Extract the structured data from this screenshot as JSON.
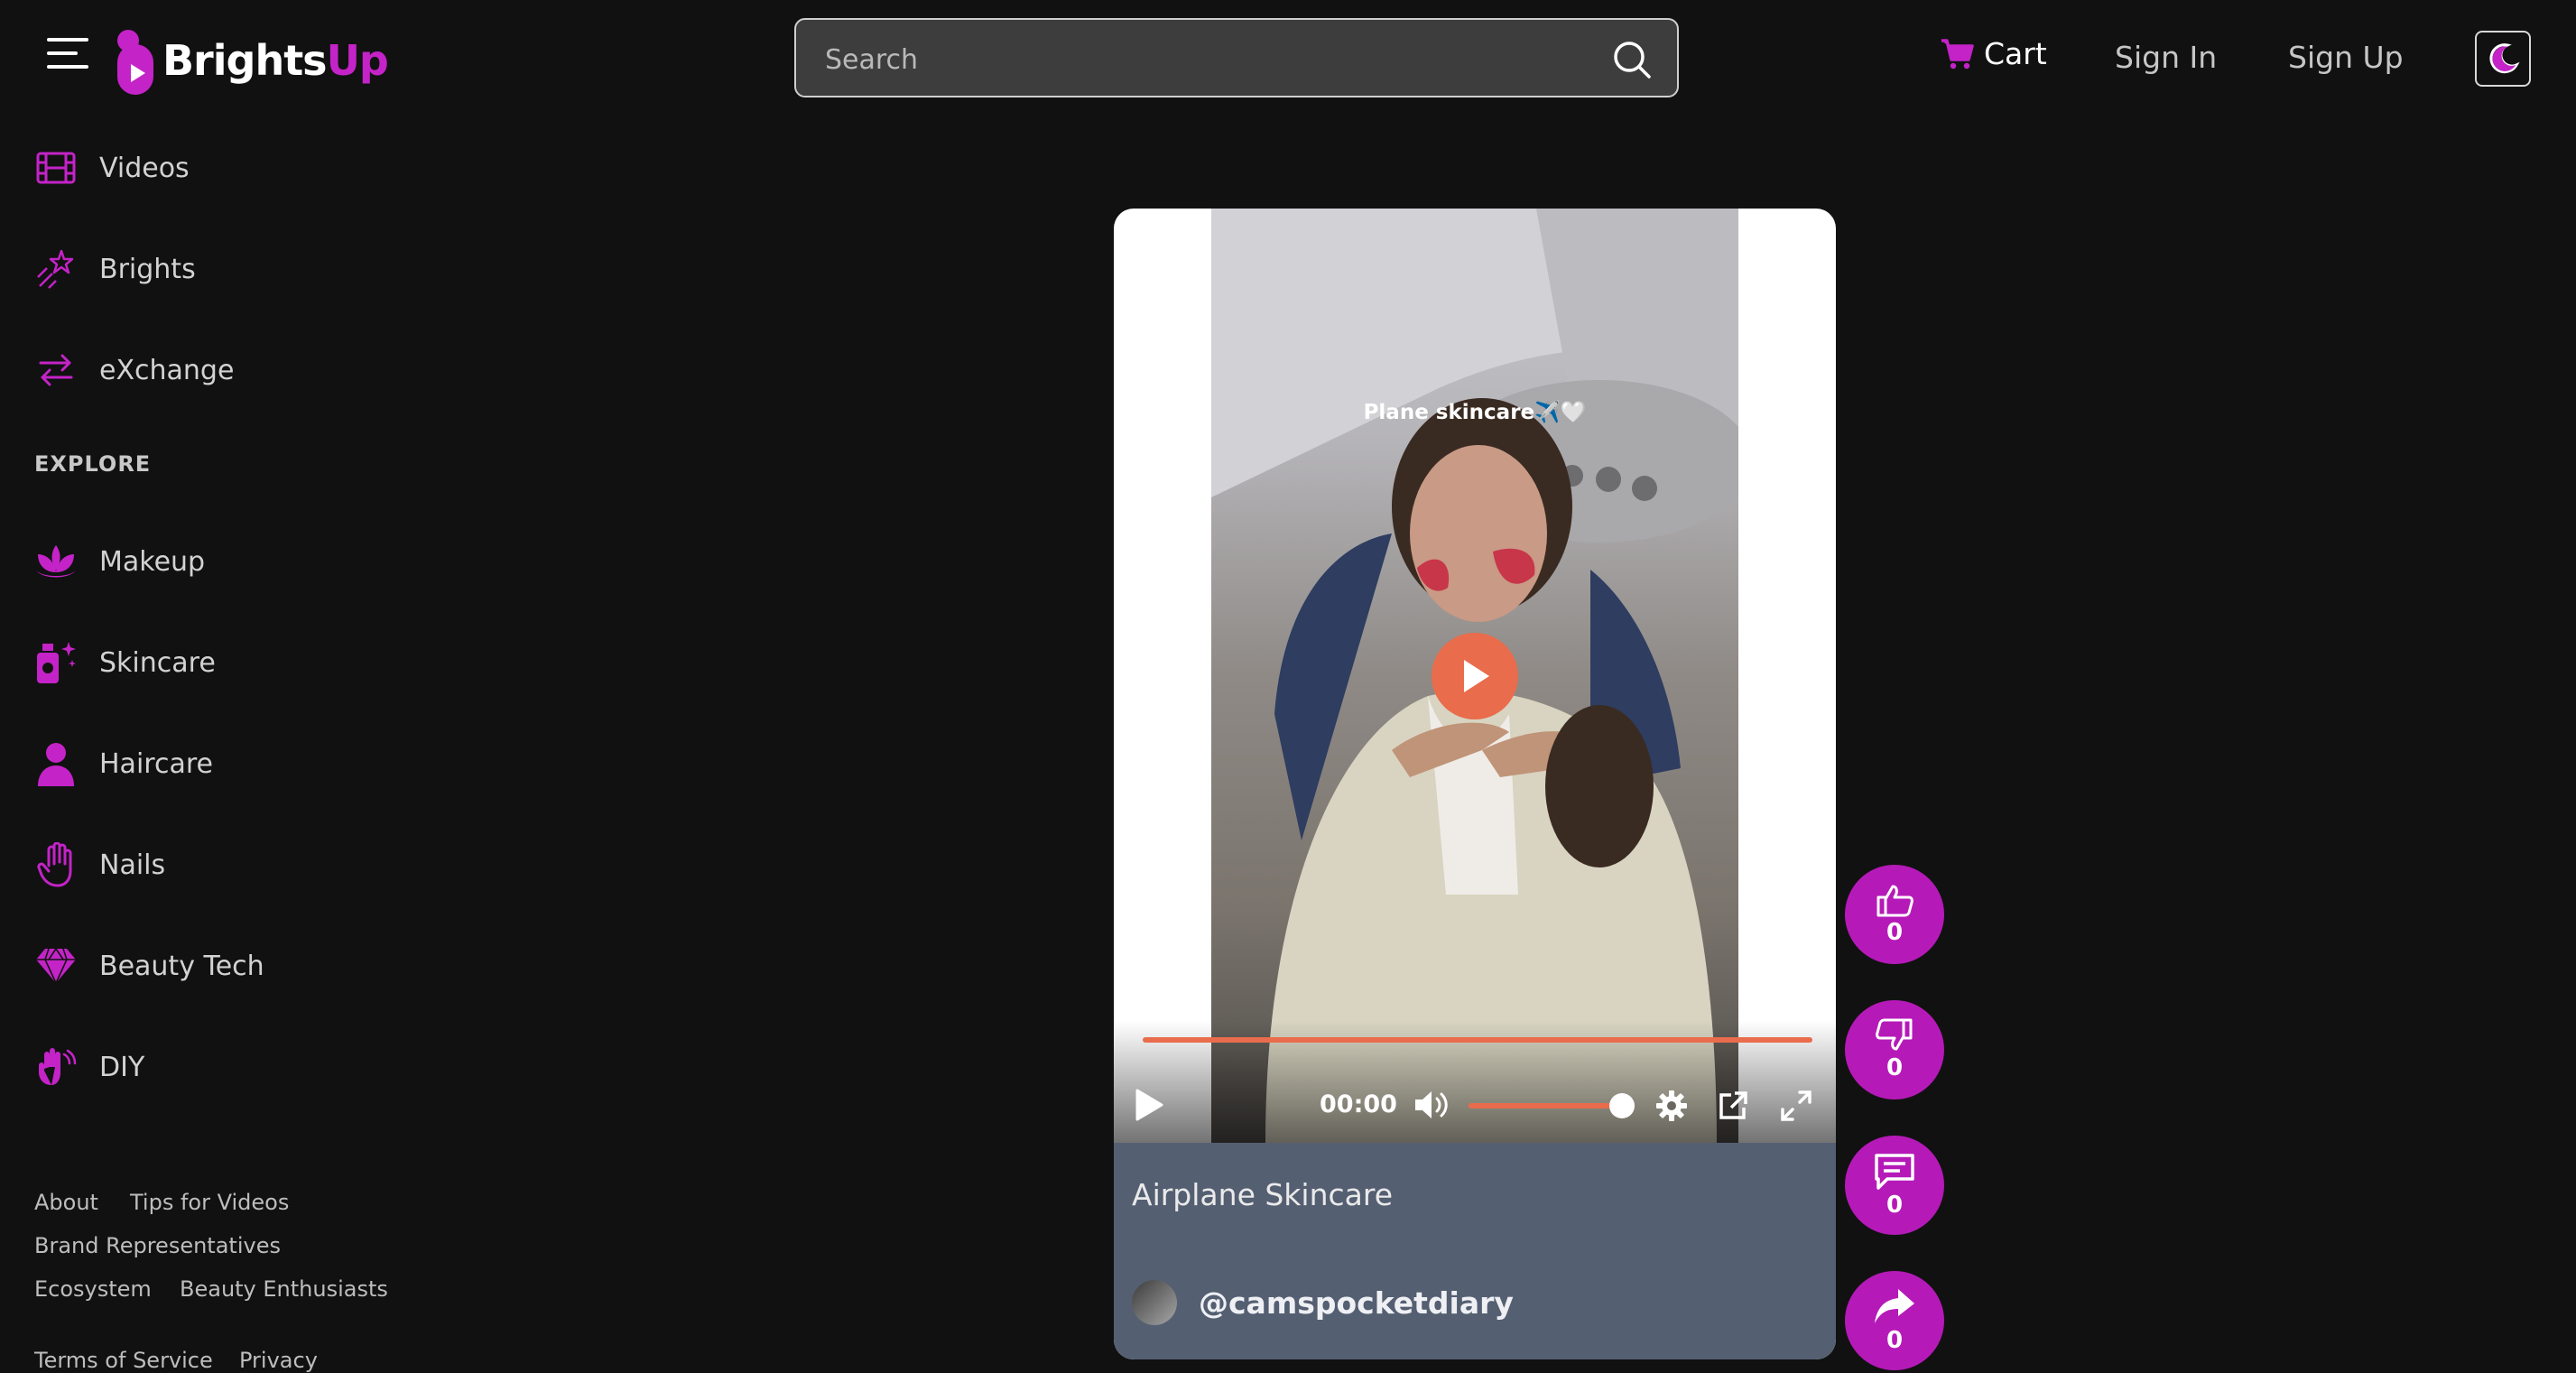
{
  "header": {
    "logo_text_a": "Brights",
    "logo_text_b": "Up",
    "search_placeholder": "Search",
    "cart_label": "Cart",
    "sign_in": "Sign In",
    "sign_up": "Sign Up"
  },
  "sidebar": {
    "items": [
      {
        "label": "Videos",
        "icon": "film-icon"
      },
      {
        "label": "Brights",
        "icon": "shooting-star-icon"
      },
      {
        "label": "eXchange",
        "icon": "exchange-arrows-icon"
      }
    ],
    "explore_heading": "EXPLORE",
    "explore_items": [
      {
        "label": "Makeup",
        "icon": "lotus-icon"
      },
      {
        "label": "Skincare",
        "icon": "bottle-sparkle-icon"
      },
      {
        "label": "Haircare",
        "icon": "person-icon"
      },
      {
        "label": "Nails",
        "icon": "hand-icon"
      },
      {
        "label": "Beauty Tech",
        "icon": "diamond-icon"
      },
      {
        "label": "DIY",
        "icon": "waving-hands-icon"
      }
    ],
    "footer_links": [
      "About",
      "Tips for Videos",
      "Brand Representatives",
      "Ecosystem",
      "Beauty Enthusiasts",
      "Terms of Service",
      "Privacy"
    ]
  },
  "video": {
    "overlay_caption": "Plane skincare✈️🤍",
    "time": "00:00",
    "progress": 1.0,
    "volume": 0.85,
    "title": "Airplane Skincare",
    "channel": "@camspocketdiary"
  },
  "actions": {
    "like_count": "0",
    "dislike_count": "0",
    "comment_count": "0",
    "share_count": "0"
  },
  "colors": {
    "brand": "#b51ab8",
    "accent": "#e96c4c",
    "background": "#111111",
    "info_panel": "#555f72"
  }
}
